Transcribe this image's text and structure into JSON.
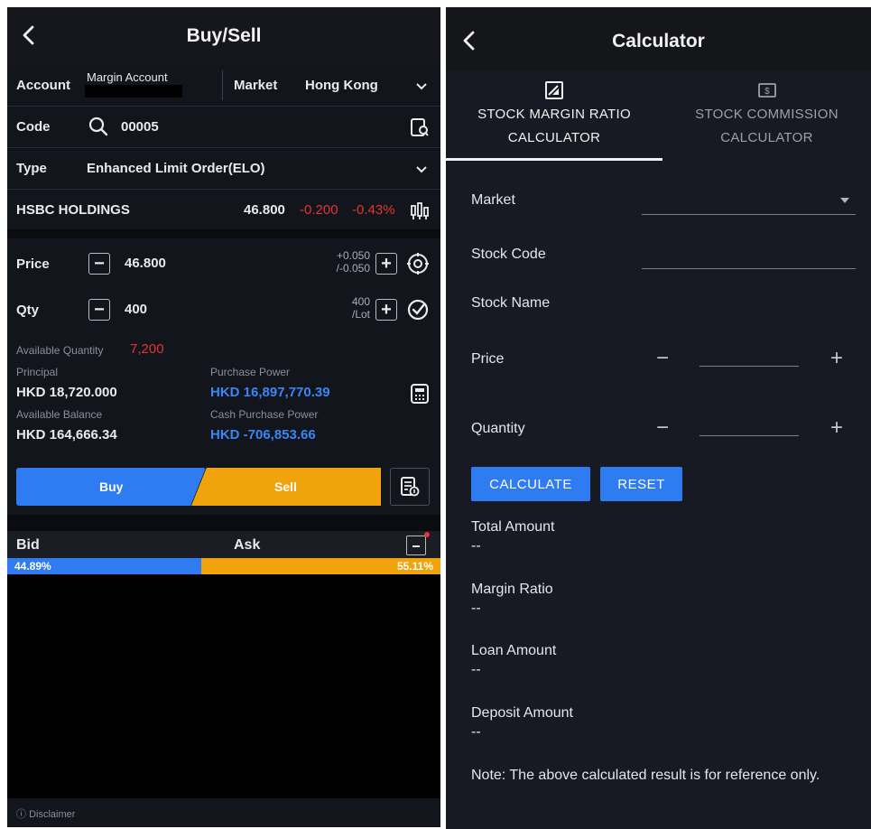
{
  "buysell": {
    "title": "Buy/Sell",
    "account_label": "Account",
    "account_value": "Margin Account",
    "market_label": "Market",
    "market_value": "Hong Kong",
    "code_label": "Code",
    "code_value": "00005",
    "type_label": "Type",
    "type_value": "Enhanced Limit Order(ELO)",
    "stock_name": "HSBC HOLDINGS",
    "stock_price": "46.800",
    "stock_change": "-0.200",
    "stock_change_pct": "-0.43%",
    "price_label": "Price",
    "price_value": "46.800",
    "price_step_up": "+0.050",
    "price_step_down": "/-0.050",
    "qty_label": "Qty",
    "qty_value": "400",
    "qty_lot_num": "400",
    "qty_lot_unit": "/Lot",
    "avail_qty_label": "Available Quantity",
    "avail_qty_value": "7,200",
    "principal_label": "Principal",
    "principal_value": "HKD 18,720.000",
    "purchase_power_label": "Purchase Power",
    "purchase_power_value": "HKD 16,897,770.39",
    "avail_balance_label": "Available Balance",
    "avail_balance_value": "HKD 164,666.34",
    "cash_pp_label": "Cash Purchase Power",
    "cash_pp_value": "HKD -706,853.66",
    "buy_label": "Buy",
    "sell_label": "Sell",
    "bid_label": "Bid",
    "ask_label": "Ask",
    "bid_pct": "44.89%",
    "ask_pct": "55.11%",
    "bid_share": 0.4489,
    "disclaimer": "Disclaimer",
    "colors": {
      "buy": "#2f7bf2",
      "sell": "#f0a30a",
      "down": "#e43434",
      "link": "#3a86f5"
    }
  },
  "calculator": {
    "title": "Calculator",
    "tabs": [
      {
        "line1": "STOCK MARGIN RATIO",
        "line2": "CALCULATOR",
        "icon": "image-edit-icon"
      },
      {
        "line1": "STOCK COMMISSION",
        "line2": "CALCULATOR",
        "icon": "dollar-bill-icon"
      }
    ],
    "market_label": "Market",
    "stock_code_label": "Stock Code",
    "stock_name_label": "Stock Name",
    "price_label": "Price",
    "quantity_label": "Quantity",
    "calculate_label": "CALCULATE",
    "reset_label": "RESET",
    "results": [
      {
        "label": "Total Amount",
        "value": "--"
      },
      {
        "label": "Margin Ratio",
        "value": "--"
      },
      {
        "label": "Loan Amount",
        "value": "--"
      },
      {
        "label": "Deposit Amount",
        "value": "--"
      }
    ],
    "note": "Note: The above calculated result is for reference only."
  }
}
